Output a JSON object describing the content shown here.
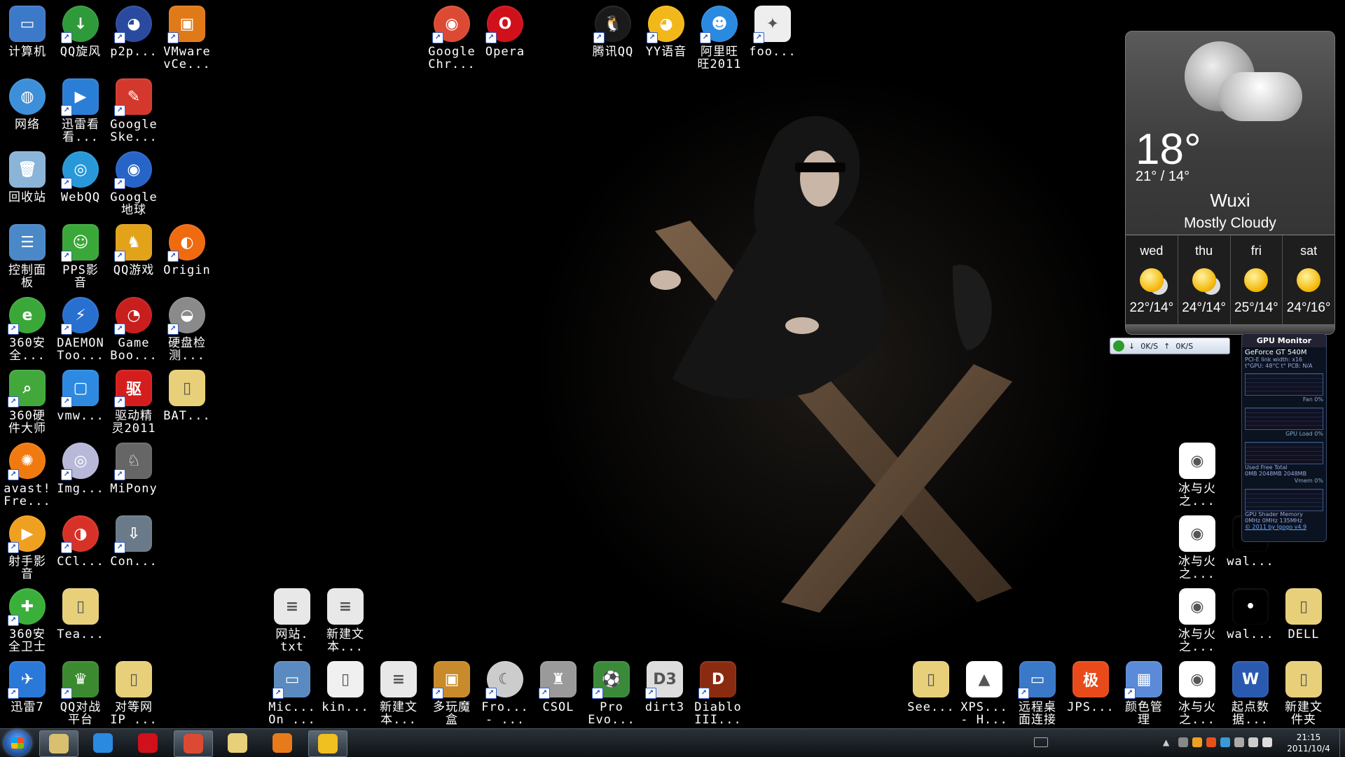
{
  "desktop": {
    "icons": [
      {
        "label": "计算机",
        "color": "#3d79c9",
        "glyph": "▭",
        "round": false,
        "shortcut": false
      },
      {
        "label": "QQ旋风",
        "color": "#2f9a3a",
        "glyph": "↓",
        "round": true,
        "shortcut": true
      },
      {
        "label": "p2p...",
        "color": "#2a4aa0",
        "glyph": "◕",
        "round": true,
        "shortcut": true
      },
      {
        "label": "VMware\nvCe...",
        "color": "#e07a18",
        "glyph": "▣",
        "round": false,
        "shortcut": true
      },
      {
        "label": "网络",
        "color": "#3c8fd8",
        "glyph": "◍",
        "round": true,
        "shortcut": false
      },
      {
        "label": "迅雷看\n看...",
        "color": "#2b7ed6",
        "glyph": "▶",
        "round": false,
        "shortcut": true
      },
      {
        "label": "Google\nSke...",
        "color": "#d4382c",
        "glyph": "✎",
        "round": false,
        "shortcut": true
      },
      {
        "label": "回收站",
        "color": "#8ab4d8",
        "glyph": "🗑",
        "round": false,
        "shortcut": false
      },
      {
        "label": "WebQQ",
        "color": "#2898d8",
        "glyph": "◎",
        "round": true,
        "shortcut": true
      },
      {
        "label": "Google\n地球",
        "color": "#2664c8",
        "glyph": "◉",
        "round": true,
        "shortcut": true
      },
      {
        "label": "控制面\n板",
        "color": "#4a88c8",
        "glyph": "☰",
        "round": false,
        "shortcut": false
      },
      {
        "label": "PPS影\n音",
        "color": "#3aa838",
        "glyph": "☺",
        "round": false,
        "shortcut": true
      },
      {
        "label": "QQ游戏",
        "color": "#e2a21a",
        "glyph": "♞",
        "round": false,
        "shortcut": true
      },
      {
        "label": "Origin",
        "color": "#f06a10",
        "glyph": "◐",
        "round": true,
        "shortcut": true
      },
      {
        "label": "360安\n全...",
        "color": "#3aa838",
        "glyph": "e",
        "round": true,
        "shortcut": true
      },
      {
        "label": "DAEMON\nToo...",
        "color": "#2870d0",
        "glyph": "⚡",
        "round": true,
        "shortcut": true
      },
      {
        "label": "Game\nBoo...",
        "color": "#c81e1e",
        "glyph": "◔",
        "round": true,
        "shortcut": true
      },
      {
        "label": "硬盘检\n测...",
        "color": "#8a8a8a",
        "glyph": "◒",
        "round": true,
        "shortcut": true
      },
      {
        "label": "360硬\n件大师",
        "color": "#42a83c",
        "glyph": "⌕",
        "round": false,
        "shortcut": true
      },
      {
        "label": "vmw...",
        "color": "#2d8ae0",
        "glyph": "▢",
        "round": false,
        "shortcut": true
      },
      {
        "label": "驱动精\n灵2011",
        "color": "#d41e1e",
        "glyph": "驱",
        "round": false,
        "shortcut": true
      },
      {
        "label": "BAT...",
        "color": "#e8cf7a",
        "glyph": "▯",
        "round": false,
        "shortcut": false
      },
      {
        "label": "avast!\nFre...",
        "color": "#f07a10",
        "glyph": "✺",
        "round": true,
        "shortcut": true
      },
      {
        "label": "Img...",
        "color": "#b8b8d8",
        "glyph": "◎",
        "round": true,
        "shortcut": true
      },
      {
        "label": "MiPony",
        "color": "#666666",
        "glyph": "♘",
        "round": false,
        "shortcut": true
      },
      {
        "label": "射手影\n音",
        "color": "#f0a020",
        "glyph": "▶",
        "round": true,
        "shortcut": true
      },
      {
        "label": "CCl...",
        "color": "#d83228",
        "glyph": "◑",
        "round": true,
        "shortcut": true
      },
      {
        "label": "Con...",
        "color": "#6a7a88",
        "glyph": "⇩",
        "round": false,
        "shortcut": true
      },
      {
        "label": "360安\n全卫士",
        "color": "#3ab03a",
        "glyph": "✚",
        "round": true,
        "shortcut": true
      },
      {
        "label": "Tea...",
        "color": "#e8cf7a",
        "glyph": "▯",
        "round": false,
        "shortcut": false
      },
      {
        "label": "迅雷7",
        "color": "#2a78d8",
        "glyph": "✈",
        "round": false,
        "shortcut": true
      },
      {
        "label": "QQ对战\n平台",
        "color": "#3b8a30",
        "glyph": "♛",
        "round": false,
        "shortcut": true
      },
      {
        "label": "对等网\nIP ...",
        "color": "#e8cf7a",
        "glyph": "▯",
        "round": false,
        "shortcut": false
      },
      {
        "label": "Google\nChr...",
        "color": "#dd4a34",
        "glyph": "◉",
        "round": true,
        "shortcut": true
      },
      {
        "label": "Opera",
        "color": "#d0101a",
        "glyph": "O",
        "round": true,
        "shortcut": true
      },
      {
        "label": "腾讯QQ",
        "color": "#1a1a1a",
        "glyph": "🐧",
        "round": true,
        "shortcut": true
      },
      {
        "label": "YY语音",
        "color": "#f2b81a",
        "glyph": "◕",
        "round": true,
        "shortcut": true
      },
      {
        "label": "阿里旺\n旺2011",
        "color": "#2a8ae0",
        "glyph": "☻",
        "round": true,
        "shortcut": true
      },
      {
        "label": "foo...",
        "color": "#eeeeee",
        "glyph": "✦",
        "round": false,
        "shortcut": true
      },
      {
        "label": "网站.\ntxt",
        "color": "#e8e8e8",
        "glyph": "≡",
        "round": false,
        "shortcut": false
      },
      {
        "label": "新建文\n本...",
        "color": "#e8e8e8",
        "glyph": "≡",
        "round": false,
        "shortcut": false
      },
      {
        "label": "Mic...\nOn ...",
        "color": "#5a8ac0",
        "glyph": "▭",
        "round": false,
        "shortcut": true
      },
      {
        "label": "kin...",
        "color": "#f0f0f0",
        "glyph": "▯",
        "round": false,
        "shortcut": false
      },
      {
        "label": "新建文\n本...",
        "color": "#e8e8e8",
        "glyph": "≡",
        "round": false,
        "shortcut": false
      },
      {
        "label": "多玩魔\n盒",
        "color": "#c88a2a",
        "glyph": "▣",
        "round": false,
        "shortcut": true
      },
      {
        "label": "Fro...\n- ...",
        "color": "#cccccc",
        "glyph": "☾",
        "round": true,
        "shortcut": true
      },
      {
        "label": "CSOL",
        "color": "#9a9a9a",
        "glyph": "♜",
        "round": false,
        "shortcut": true
      },
      {
        "label": "Pro\nEvo...",
        "color": "#3a8a3a",
        "glyph": "⚽",
        "round": false,
        "shortcut": true
      },
      {
        "label": "dirt3",
        "color": "#dddddd",
        "glyph": "D3",
        "round": false,
        "shortcut": true
      },
      {
        "label": "Diablo\nIII...",
        "color": "#8a2a10",
        "glyph": "D",
        "round": false,
        "shortcut": true
      },
      {
        "label": "冰与火\n之...",
        "color": "#ffffff",
        "glyph": "◉",
        "round": false,
        "shortcut": false
      },
      {
        "label": "冰与火\n之...",
        "color": "#ffffff",
        "glyph": "◉",
        "round": false,
        "shortcut": false
      },
      {
        "label": "wal...",
        "color": "#000000",
        "glyph": "",
        "round": false,
        "shortcut": false
      },
      {
        "label": "冰与火\n之...",
        "color": "#ffffff",
        "glyph": "◉",
        "round": false,
        "shortcut": false
      },
      {
        "label": "wal...",
        "color": "#000000",
        "glyph": "•",
        "round": false,
        "shortcut": false
      },
      {
        "label": "DELL",
        "color": "#e8cf7a",
        "glyph": "▯",
        "round": false,
        "shortcut": false
      },
      {
        "label": "See...",
        "color": "#e8cf7a",
        "glyph": "▯",
        "round": false,
        "shortcut": false
      },
      {
        "label": "XPS...\n- H...",
        "color": "#ffffff",
        "glyph": "▲",
        "round": false,
        "shortcut": false
      },
      {
        "label": "远程桌\n面连接",
        "color": "#3a78c8",
        "glyph": "▭",
        "round": false,
        "shortcut": true
      },
      {
        "label": "JPS...",
        "color": "#e84a1a",
        "glyph": "极",
        "round": false,
        "shortcut": false
      },
      {
        "label": "颜色管\n理",
        "color": "#5a8ad8",
        "glyph": "▦",
        "round": false,
        "shortcut": true
      },
      {
        "label": "冰与火\n之...",
        "color": "#ffffff",
        "glyph": "◉",
        "round": false,
        "shortcut": false
      },
      {
        "label": "起点数\n据...",
        "color": "#2a5ab0",
        "glyph": "W",
        "round": false,
        "shortcut": false
      },
      {
        "label": "新建文\n件夹",
        "color": "#e8cf7a",
        "glyph": "▯",
        "round": false,
        "shortcut": false
      }
    ]
  },
  "weather": {
    "temp": "18°",
    "range": "21° / 14°",
    "city": "Wuxi",
    "condition": "Mostly Cloudy",
    "forecast": [
      {
        "day": "wed",
        "range": "22°/14°",
        "icon": "partly-cloudy-icon"
      },
      {
        "day": "thu",
        "range": "24°/14°",
        "icon": "partly-cloudy-icon"
      },
      {
        "day": "fri",
        "range": "25°/14°",
        "icon": "sunny-icon"
      },
      {
        "day": "sat",
        "range": "24°/16°",
        "icon": "sunny-icon"
      }
    ]
  },
  "netspeed": {
    "down": "0K/S",
    "up": "0K/S"
  },
  "gpu": {
    "title": "GPU Monitor",
    "model": "GeForce GT 540M",
    "link": "PCI-E link width: x16",
    "temps": "t°GPU: 48°C    t° PCB: N/A",
    "fan": "Fan 0%",
    "load": "GPU Load 0%",
    "mem_head": "Used    Free    Total",
    "mem_vals": "0MB   2048MB  2048MB",
    "vmem": "Vmem 0%",
    "clk_head": "GPU   Shader  Memory",
    "clk_vals": "0MHz   0MHz   135MHz",
    "footer": "© 2011 by Igogo    v4.9"
  },
  "taskbar": {
    "apps": [
      {
        "name": "weather-app",
        "color": "#d8c070",
        "active": true
      },
      {
        "name": "ie",
        "color": "#2a8ae0",
        "active": false
      },
      {
        "name": "opera",
        "color": "#d0101a",
        "active": false
      },
      {
        "name": "chrome",
        "color": "#dd4a34",
        "active": true
      },
      {
        "name": "explorer",
        "color": "#e8cf7a",
        "active": false
      },
      {
        "name": "media-player",
        "color": "#e87a1a",
        "active": false
      },
      {
        "name": "qq",
        "color": "#f0c020",
        "active": true
      }
    ],
    "time": "21:15",
    "date": "2011/10/4"
  }
}
